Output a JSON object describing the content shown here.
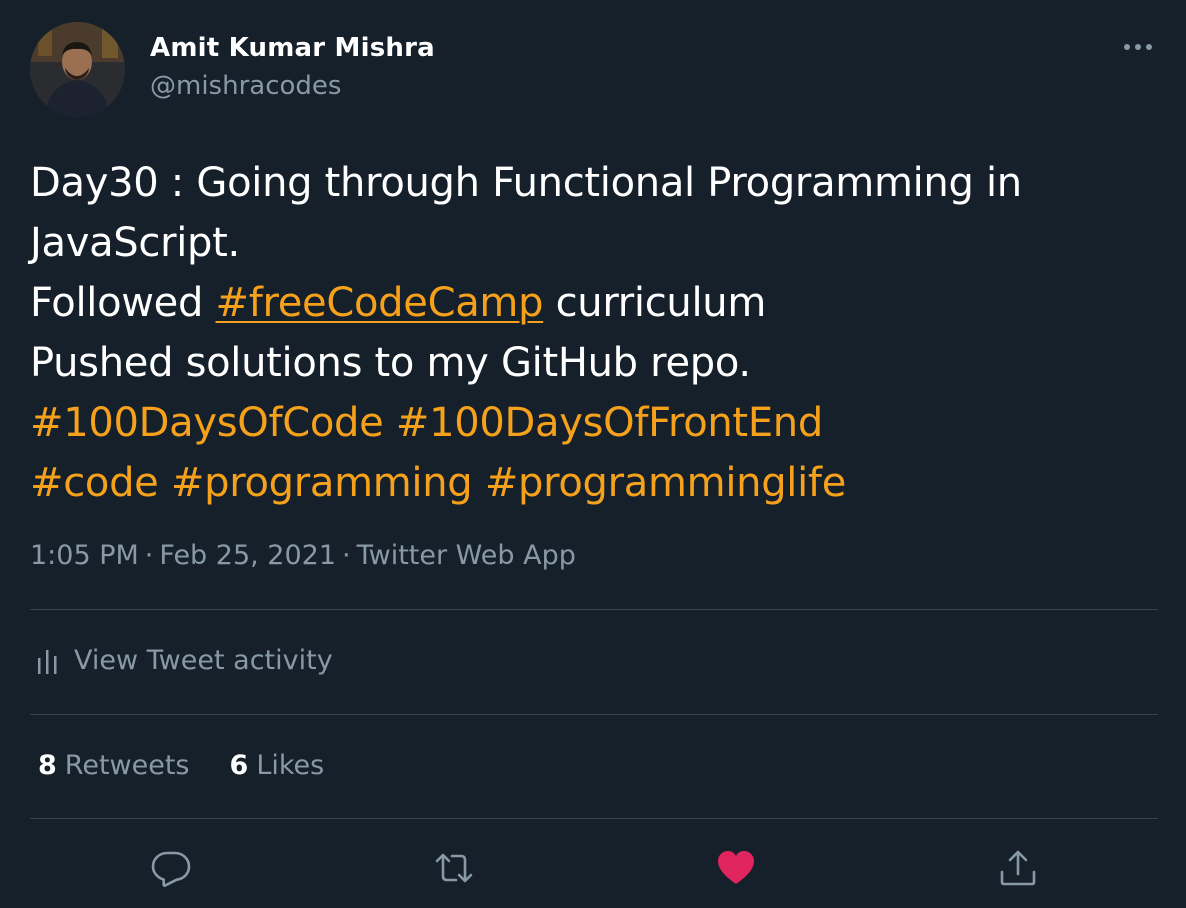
{
  "author": {
    "name": "Amit Kumar Mishra",
    "handle": "@mishracodes"
  },
  "tweet": {
    "line1": "Day30 : Going through Functional Programming in",
    "line2": "JavaScript.",
    "line3_prefix": "Followed ",
    "line3_hashtag": "#freeCodeCamp",
    "line3_suffix": " curriculum",
    "line4": "Pushed solutions to my GitHub repo.",
    "hashtags_line5": [
      "#100DaysOfCode",
      "#100DaysOfFrontEnd"
    ],
    "hashtags_line6": [
      "#code",
      "#programming",
      "#programminglife"
    ]
  },
  "meta": {
    "time": "1:05 PM",
    "date": "Feb 25, 2021",
    "source": "Twitter Web App",
    "separator": "·"
  },
  "activity": {
    "label": "View Tweet activity"
  },
  "stats": {
    "retweets_count": "8",
    "retweets_label": "Retweets",
    "likes_count": "6",
    "likes_label": "Likes"
  },
  "actions": {
    "reply_icon": "reply-icon",
    "retweet_icon": "retweet-icon",
    "like_icon": "heart-icon",
    "share_icon": "share-icon",
    "liked": true
  },
  "colors": {
    "background": "#15202b",
    "text": "#ffffff",
    "secondary": "#8899a6",
    "hashtag": "#f6a11b",
    "divider": "#38444d",
    "like": "#e0245e"
  }
}
